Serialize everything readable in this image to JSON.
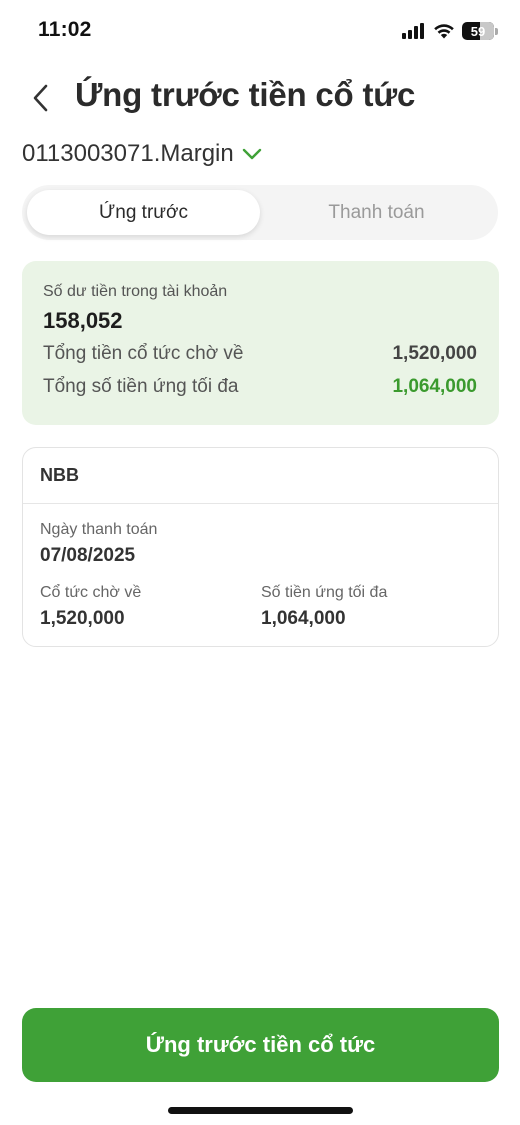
{
  "status_bar": {
    "time": "11:02",
    "battery_level": "59",
    "icons": [
      "signal-icon",
      "wifi-icon",
      "battery-icon"
    ]
  },
  "header": {
    "title": "Ứng trước tiền cổ tức",
    "back_icon": "chevron-left-icon"
  },
  "account": {
    "label": "0113003071.Margin",
    "dropdown_icon": "chevron-down-icon"
  },
  "tabs": [
    {
      "label": "Ứng trước",
      "active": true
    },
    {
      "label": "Thanh toán",
      "active": false
    }
  ],
  "summary": {
    "balance_label": "Số dư tiền trong tài khoản",
    "balance_value": "158,052",
    "pending_label": "Tổng tiền cổ tức chờ về",
    "pending_value": "1,520,000",
    "max_advance_label": "Tổng số tiền ứng tối đa",
    "max_advance_value": "1,064,000"
  },
  "stock_card": {
    "symbol": "NBB",
    "payment_date_label": "Ngày thanh toán",
    "payment_date_value": "07/08/2025",
    "dividend_label": "Cổ tức chờ về",
    "dividend_value": "1,520,000",
    "max_advance_label": "Số tiền ứng tối đa",
    "max_advance_value": "1,064,000"
  },
  "primary_button": {
    "label": "Ứng trước tiền cổ tức"
  },
  "colors": {
    "accent_green": "#3fa137",
    "summary_bg": "#eaf4e6",
    "positive_value": "#3b9a2e"
  }
}
